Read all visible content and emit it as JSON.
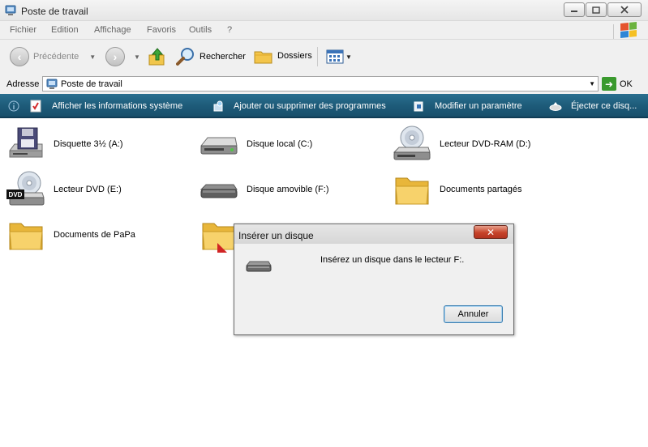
{
  "window": {
    "title": "Poste de travail"
  },
  "menu": {
    "items": [
      "Fichier",
      "Edition",
      "Affichage",
      "Favoris",
      "Outils",
      "?"
    ]
  },
  "toolbar": {
    "back_label": "Précédente",
    "search_label": "Rechercher",
    "folders_label": "Dossiers"
  },
  "address": {
    "label": "Adresse",
    "value": "Poste de travail",
    "go_label": "OK"
  },
  "tasks": [
    {
      "label": "Afficher les informations système",
      "icon": "system-info-icon"
    },
    {
      "label": "Ajouter ou supprimer des programmes",
      "icon": "add-remove-programs-icon"
    },
    {
      "label": "Modifier un paramètre",
      "icon": "control-panel-icon"
    },
    {
      "label": "Éjecter ce disq...",
      "icon": "eject-icon"
    }
  ],
  "items": [
    {
      "label": "Disquette 3½ (A:)",
      "icon": "floppy-drive-icon"
    },
    {
      "label": "Disque local (C:)",
      "icon": "hard-disk-icon"
    },
    {
      "label": "Lecteur DVD-RAM (D:)",
      "icon": "dvd-ram-drive-icon"
    },
    {
      "label": "Lecteur DVD (E:)",
      "icon": "dvd-drive-icon"
    },
    {
      "label": "Disque amovible (F:)",
      "icon": "removable-disk-icon"
    },
    {
      "label": "Documents partagés",
      "icon": "folder-icon"
    },
    {
      "label": "Documents de PaPa",
      "icon": "folder-icon"
    }
  ],
  "dialog": {
    "title": "Insérer un disque",
    "message": "Insérez un disque dans le lecteur F:.",
    "cancel_label": "Annuler"
  },
  "colors": {
    "taskbar": "#1d5a78",
    "folder": "#f3c54b",
    "close_button": "#c7432a",
    "dvd_badge": "#111111"
  }
}
